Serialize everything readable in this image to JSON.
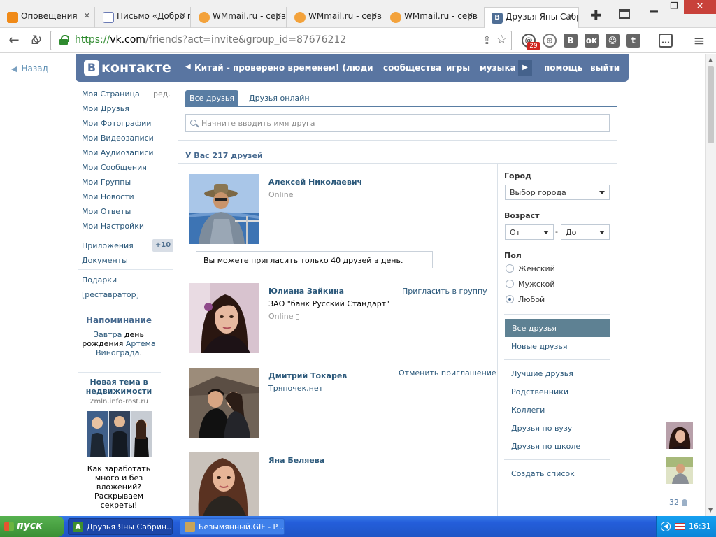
{
  "browser": {
    "tabs": [
      {
        "label": "Оповещения",
        "favicon": "odnoklassniki-icon"
      },
      {
        "label": "Письмо «Добро п",
        "favicon": "mail-icon"
      },
      {
        "label": "WMmail.ru - серв",
        "favicon": "wmmail-icon"
      },
      {
        "label": "WMmail.ru - серв",
        "favicon": "wmmail-icon"
      },
      {
        "label": "WMmail.ru - серв",
        "favicon": "wmmail-icon"
      },
      {
        "label": "Друзья Яны Сабри",
        "favicon": "vk-icon",
        "active": true
      }
    ],
    "url": {
      "scheme": "https://",
      "host": "vk.com",
      "rest": "/friends?act=invite&group_id=87676212"
    },
    "extensions": {
      "mail_badge": "29"
    }
  },
  "vk": {
    "back_label": "Назад",
    "logo_letter": "В",
    "logo_word": "контакте",
    "header": {
      "ad": "Китай - проверено временем! (...",
      "links": [
        "люди",
        "сообщества",
        "игры",
        "музыка"
      ],
      "help": "помощь",
      "logout": "выйти"
    },
    "nav": {
      "items": [
        "Моя Страница",
        "Мои Друзья",
        "Мои Фотографии",
        "Мои Видеозаписи",
        "Мои Аудиозаписи",
        "Мои Сообщения",
        "Мои Группы",
        "Мои Новости",
        "Мои Ответы",
        "Мои Настройки"
      ],
      "edit": "ред.",
      "apps": "Приложения",
      "apps_count": "+10",
      "docs": "Документы",
      "gifts": "Подарки",
      "restorer": "[реставратор]"
    },
    "reminder": {
      "title": "Напоминание",
      "word_tomorrow": "Завтра",
      "word_day": "день",
      "word_birthday": "рождения",
      "person": "Артёма Винограда",
      "period": "."
    },
    "ad": {
      "title": "Новая тема в недвижимости",
      "domain": "2mln.info-rost.ru",
      "text": "Как заработать много и без вложений? Раскрываем секреты!"
    },
    "tabs": {
      "all": "Все друзья",
      "online": "Друзья онлайн"
    },
    "search_placeholder": "Начните вводить имя друга",
    "friends_count": "У Вас 217 друзей",
    "limit_notice": "Вы можете пригласить только 40 друзей в день.",
    "friends": [
      {
        "name": "Алексей Николаевич",
        "status": "Online"
      },
      {
        "name": "Юлиана Зайкина",
        "sub": "ЗАО \"банк Русский Стандарт\"",
        "status": "Online",
        "action": "Пригласить в группу"
      },
      {
        "name": "Дмитрий Токарев",
        "sub": "Тряпочек.нет",
        "action": "Отменить приглашение"
      },
      {
        "name": "Яна Беляева"
      }
    ],
    "filters": {
      "city_label": "Город",
      "city_value": "Выбор города",
      "age_label": "Возраст",
      "age_from": "От",
      "age_to": "До",
      "age_dash": "-",
      "sex_label": "Пол",
      "sex_options": [
        "Женский",
        "Мужской",
        "Любой"
      ],
      "sex_selected": 2
    },
    "categories": {
      "all": "Все друзья",
      "new": "Новые друзья",
      "best": "Лучшие друзья",
      "relatives": "Родственники",
      "colleagues": "Коллеги",
      "university": "Друзья по вузу",
      "school": "Друзья по школе",
      "create": "Создать список"
    },
    "online_count": "32"
  },
  "taskbar": {
    "start": "пуск",
    "tasks": [
      "Друзья Яны Сабрин...",
      "Безымянный.GIF - P..."
    ],
    "time": "16:31"
  }
}
